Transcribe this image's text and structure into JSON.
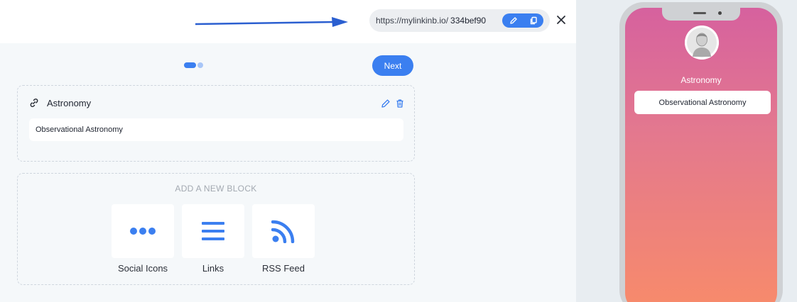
{
  "header": {
    "url_prefix": "https://mylinkinb.io/",
    "url_slug": "334bef90"
  },
  "wizard": {
    "next_label": "Next"
  },
  "link_block": {
    "title": "Astronomy",
    "link_value": "Observational Astronomy"
  },
  "add_block": {
    "title": "ADD A NEW BLOCK",
    "options": [
      {
        "label": "Social Icons",
        "icon": "more-dots-icon"
      },
      {
        "label": "Links",
        "icon": "list-icon"
      },
      {
        "label": "RSS Feed",
        "icon": "rss-icon"
      }
    ]
  },
  "preview": {
    "profile_name": "Astronomy",
    "link_label": "Observational Astronomy"
  },
  "colors": {
    "accent": "#3b7ff0",
    "gradient_top": "#d6619e",
    "gradient_bottom": "#f88b6a"
  }
}
